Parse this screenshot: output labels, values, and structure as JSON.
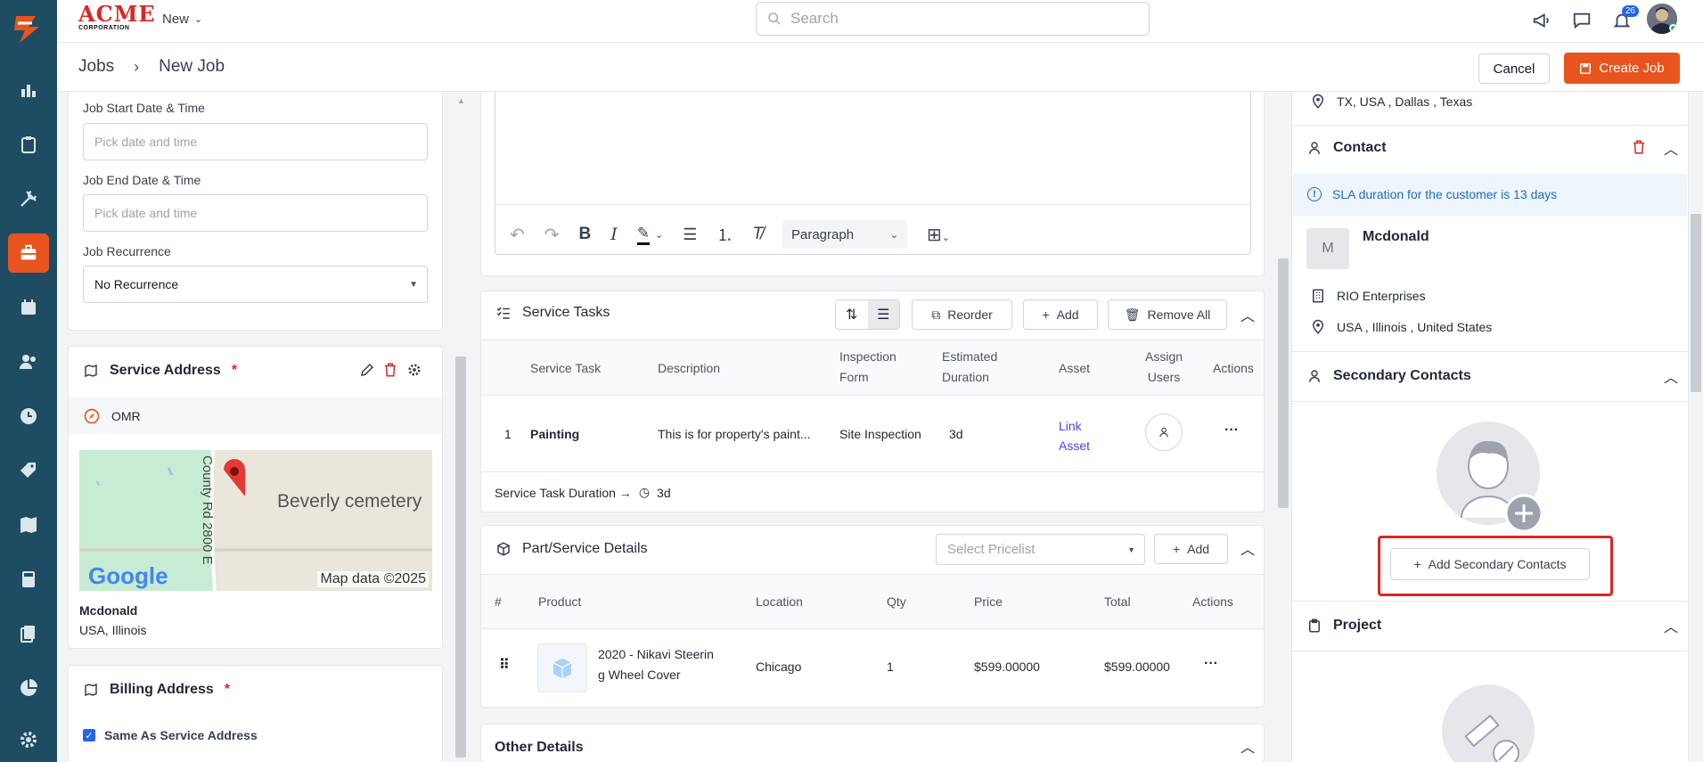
{
  "app": {
    "logo_text": "ACME",
    "logo_sub": "CORPORATION",
    "new_label": "New",
    "notifications_count": "26"
  },
  "search": {
    "placeholder": "Search"
  },
  "breadcrumb": {
    "root": "Jobs",
    "current": "New Job"
  },
  "actions": {
    "cancel": "Cancel",
    "create": "Create Job"
  },
  "left": {
    "start_label": "Job Start Date & Time",
    "start_placeholder": "Pick date and time",
    "end_label": "Job End Date & Time",
    "end_placeholder": "Pick date and time",
    "recurrence_label": "Job Recurrence",
    "recurrence_value": "No Recurrence",
    "service_address_title": "Service Address",
    "service_address_tag": "OMR",
    "map_place": "Beverly cemetery",
    "map_road": "County Rd 2800 E",
    "map_credit": "Map data ©2025",
    "map_brand": "Google",
    "addr_name": "Mcdonald",
    "addr_line": "USA, Illinois",
    "billing_title": "Billing Address",
    "billing_same": "Same As Service Address"
  },
  "editor": {
    "paragraph": "Paragraph"
  },
  "tasks": {
    "title": "Service Tasks",
    "reorder": "Reorder",
    "add": "Add",
    "remove_all": "Remove All",
    "columns": [
      "Service Task",
      "Description",
      "Inspection\nForm",
      "Estimated\nDuration",
      "Asset",
      "Assign\nUsers",
      "Actions"
    ],
    "rows": [
      {
        "num": "1",
        "task": "Painting",
        "desc": "This is for property's paint...",
        "form": "Site Inspection",
        "duration": "3d",
        "asset": "Link\nAsset"
      }
    ],
    "duration_label": "Service Task Duration →",
    "duration_value": "3d"
  },
  "parts": {
    "title": "Part/Service Details",
    "pricelist_placeholder": "Select Pricelist",
    "add": "Add",
    "columns": [
      "#",
      "Product",
      "Location",
      "Qty",
      "Price",
      "Total",
      "Actions"
    ],
    "rows": [
      {
        "product": "2020 - Nikavi Steerin\ng Wheel Cover",
        "location": "Chicago",
        "qty": "1",
        "price": "$599.00000",
        "total": "$599.00000"
      }
    ]
  },
  "other": {
    "title": "Other Details"
  },
  "right": {
    "top_location": "TX, USA , Dallas , Texas",
    "contact_title": "Contact",
    "sla": "SLA duration for the customer is 13 days",
    "contact_initial": "M",
    "contact_name": "Mcdonald",
    "company": "RIO Enterprises",
    "location": "USA , Illinois , United States",
    "secondary_title": "Secondary Contacts",
    "add_secondary": "Add Secondary Contacts",
    "project_title": "Project"
  },
  "colors": {
    "accent": "#e8541e",
    "sidebar": "#1e4d63",
    "link": "#4f46e5",
    "highlight": "#dc2626"
  }
}
